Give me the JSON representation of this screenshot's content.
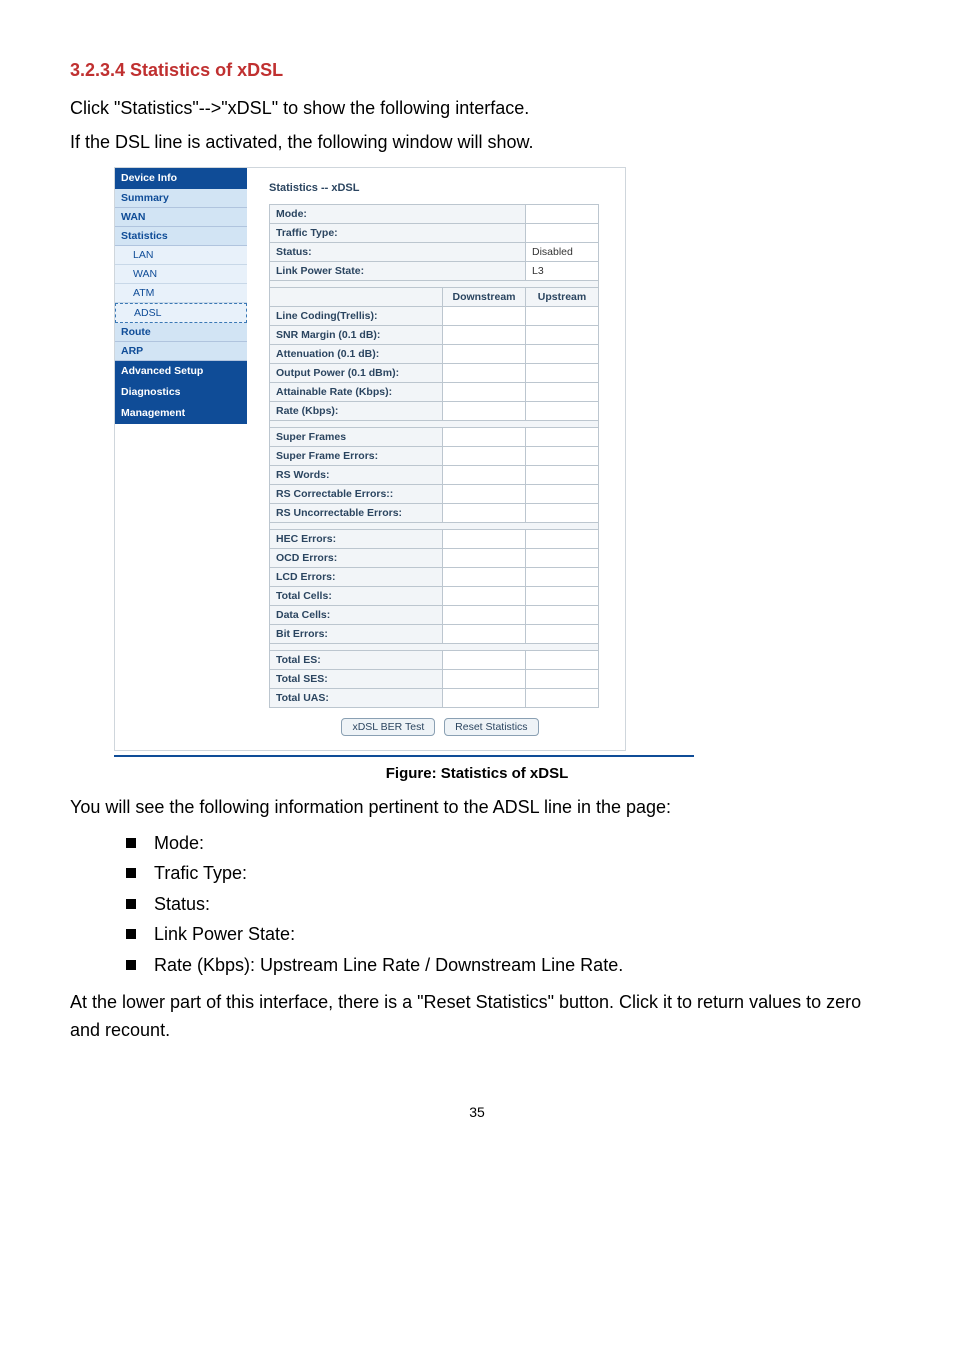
{
  "heading": "3.2.3.4 Statistics of xDSL",
  "intro1": "Click \"Statistics\"-->\"xDSL\" to show the following interface.",
  "intro2": "If the DSL line is activated, the following window will show.",
  "screenshot": {
    "nav": {
      "header_device_info": "Device Info",
      "item_summary": "Summary",
      "item_wan": "WAN",
      "item_statistics": "Statistics",
      "sub_lan": "LAN",
      "sub_wan": "WAN",
      "sub_atm": "ATM",
      "sub_adsl": "ADSL",
      "item_route": "Route",
      "item_arp": "ARP",
      "header_advanced": "Advanced Setup",
      "header_diagnostics": "Diagnostics",
      "header_management": "Management"
    },
    "main": {
      "title": "Statistics -- xDSL",
      "row_mode": "Mode:",
      "row_traffic_type": "Traffic Type:",
      "row_status": "Status:",
      "row_status_val": "Disabled",
      "row_link_power": "Link Power State:",
      "row_link_power_val": "L3",
      "col_downstream": "Downstream",
      "col_upstream": "Upstream",
      "row_line_coding": "Line Coding(Trellis):",
      "row_snr_margin": "SNR Margin (0.1 dB):",
      "row_attenuation": "Attenuation (0.1 dB):",
      "row_output_power": "Output Power (0.1 dBm):",
      "row_attainable_rate": "Attainable Rate (Kbps):",
      "row_rate": "Rate (Kbps):",
      "row_super_frames": "Super Frames",
      "row_super_frame_errors": "Super Frame Errors:",
      "row_rs_words": "RS Words:",
      "row_rs_correctable": "RS Correctable Errors::",
      "row_rs_uncorrectable": "RS Uncorrectable Errors:",
      "row_hec": "HEC Errors:",
      "row_ocd": "OCD Errors:",
      "row_lcd": "LCD Errors:",
      "row_total_cells": "Total Cells:",
      "row_data_cells": "Data Cells:",
      "row_bit_errors": "Bit Errors:",
      "row_total_es": "Total ES:",
      "row_total_ses": "Total SES:",
      "row_total_uas": "Total UAS:",
      "btn_ber": "xDSL BER Test",
      "btn_reset": "Reset Statistics"
    }
  },
  "caption": "Figure: Statistics of xDSL",
  "paragraph_after": "You will see the following information pertinent to the ADSL line in the page:",
  "bullets": {
    "mode": "Mode:",
    "trafic_type": "Trafic Type:",
    "status": "Status:",
    "link_power_state": "Link Power State:",
    "rate": "Rate (Kbps): Upstream Line Rate / Downstream Line Rate."
  },
  "closing": "At the lower part of this interface, there is a \"Reset Statistics\" button. Click it to return values to zero and recount.",
  "pagenum": "35"
}
